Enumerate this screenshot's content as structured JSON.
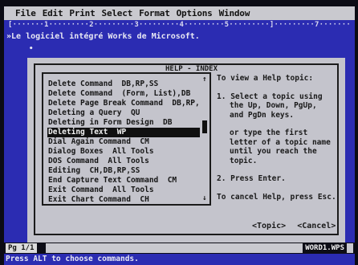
{
  "menubar": {
    "items": [
      "File",
      "Edit",
      "Print",
      "Select",
      "Format",
      "Options",
      "Window"
    ]
  },
  "ruler": "[·······1·········2·········3·········4·········5·········]·········7·······",
  "document": {
    "first_line": "»Le logiciel intégré Works de Microsoft.",
    "bullet": "•"
  },
  "help_dialog": {
    "title": "HELP - INDEX",
    "topics": [
      "Delete Command  DB,RP,SS",
      "Delete Command  (Form, List),DB",
      "Delete Page Break Command  DB,RP,SS",
      "Deleting a Query  QU",
      "Deleting in Form Design  DB",
      "Deleting Text  WP",
      "Dial Again Command  CM",
      "Dialog Boxes  All Tools",
      "DOS Command  All Tools",
      "Editing  CH,DB,RP,SS",
      "End Capture Text Command  CM",
      "Exit Command  All Tools",
      "Exit Chart Command  CH"
    ],
    "selected_index": 5,
    "scroll_up": "↑",
    "scroll_down": "↓",
    "help_text": {
      "intro": "To view a Help topic:",
      "step1_num": "1.",
      "step1_lines": [
        "Select a topic using",
        "the Up, Down, PgUp,",
        "and PgDn keys."
      ],
      "alt_lines": [
        "or type the first",
        "letter of a topic name",
        "until you reach the",
        "topic."
      ],
      "step2": "2. Press Enter.",
      "cancel": "To cancel Help, press Esc."
    },
    "buttons": {
      "topic": "<Topic>",
      "cancel": "<Cancel>"
    }
  },
  "status": {
    "page": "Pg 1/1",
    "document_name": "WORD1.WPS",
    "message": "Press ALT to choose commands."
  }
}
